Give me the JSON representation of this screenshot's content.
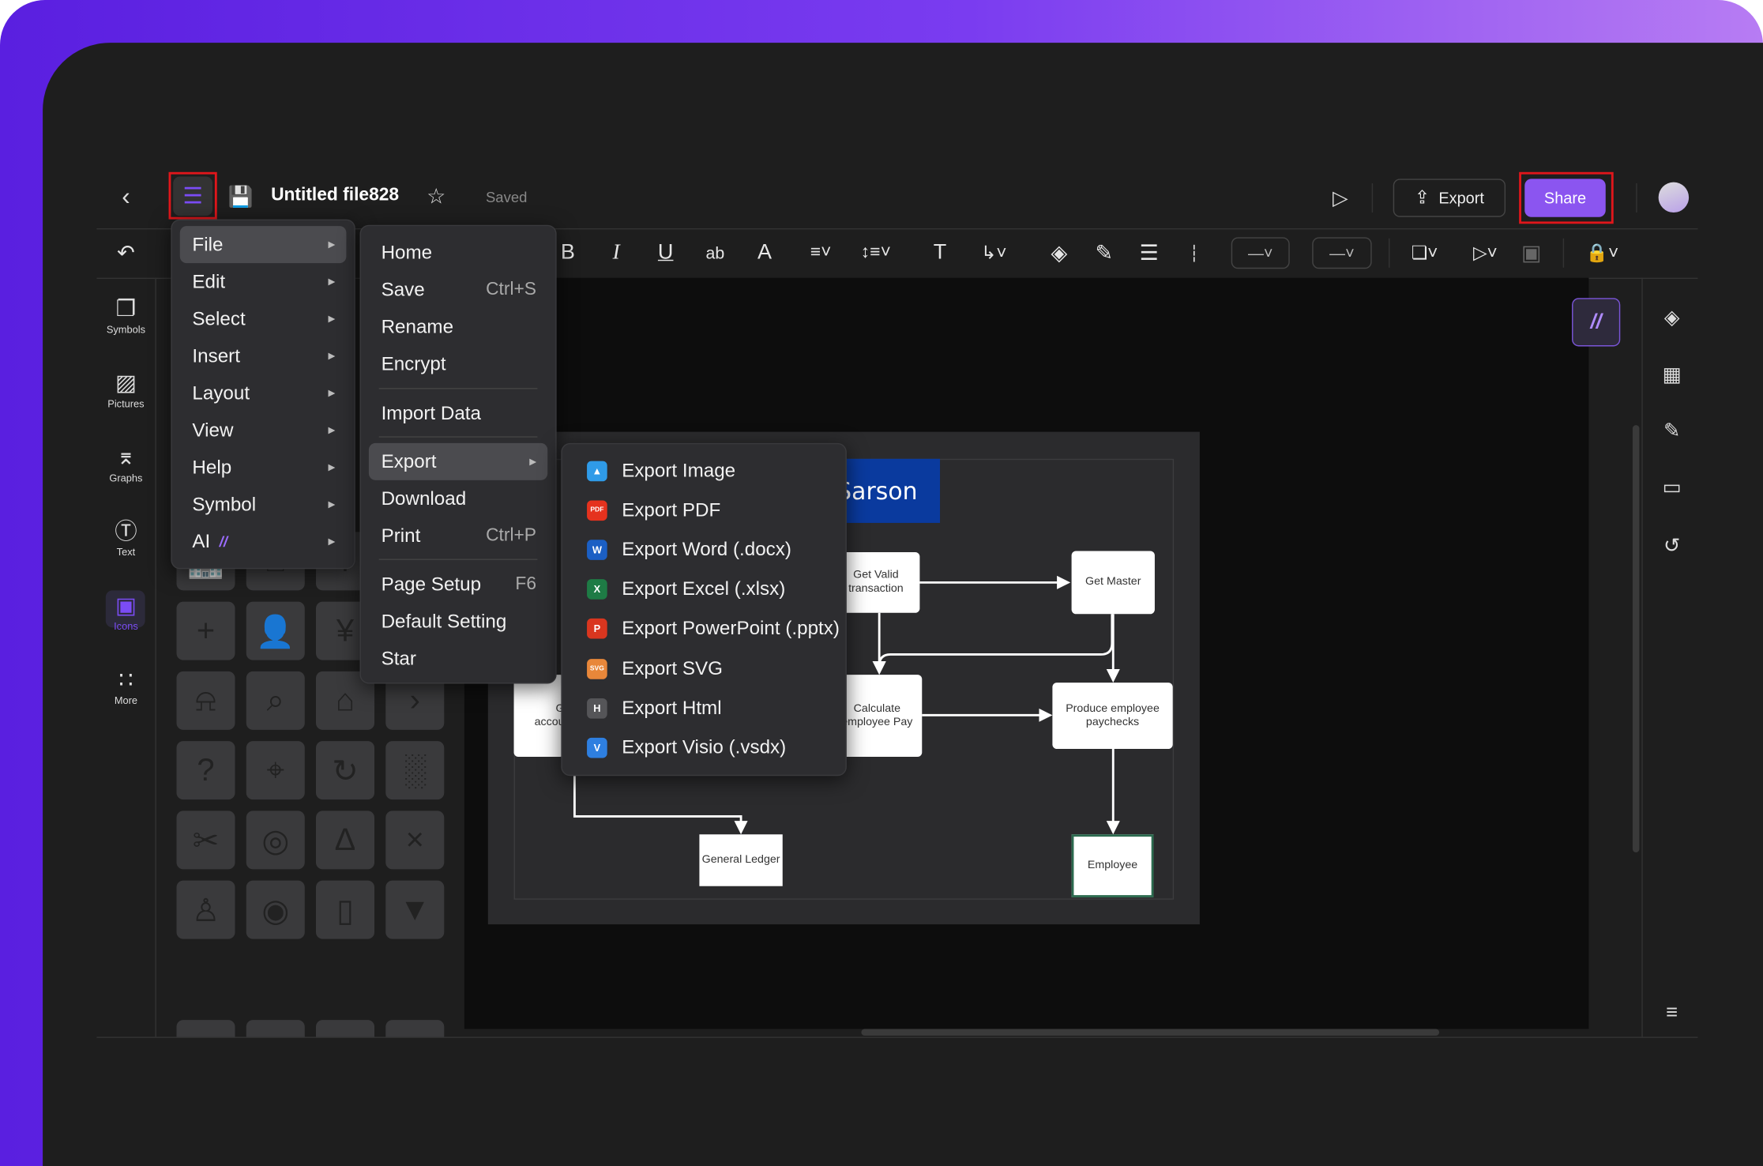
{
  "header": {
    "title": "Untitled file828",
    "status": "Saved",
    "export_label": "Export",
    "share_label": "Share"
  },
  "colors": {
    "accent": "#8b55f0",
    "highlight_outline": "#e0161b",
    "diagram_title_bg": "#0a3a9e"
  },
  "sidebar": {
    "items": [
      {
        "label": "Symbols",
        "icon": "symbols-icon"
      },
      {
        "label": "Pictures",
        "icon": "pictures-icon"
      },
      {
        "label": "Graphs",
        "icon": "graphs-icon"
      },
      {
        "label": "Text",
        "icon": "text-icon"
      },
      {
        "label": "Icons",
        "icon": "icons-icon",
        "active": true
      },
      {
        "label": "More",
        "icon": "more-icon"
      }
    ]
  },
  "icon_grid": [
    "building-icon",
    "easel-icon",
    "money-icon",
    "check-icon",
    "plus-icon",
    "contact-card-icon",
    "yen-transfer-icon",
    "chevron-down-icon",
    "bell-icon",
    "search-icon",
    "store-icon",
    "chevron-right-icon",
    "help-icon",
    "location-icon",
    "refresh-icon",
    "barcode-icon",
    "scissors-icon",
    "target-icon",
    "compass-icon",
    "close-icon",
    "stamp-icon",
    "disc-icon",
    "usb-icon",
    "pin-icon"
  ],
  "main_menu": {
    "items": [
      {
        "label": "File"
      },
      {
        "label": "Edit"
      },
      {
        "label": "Select"
      },
      {
        "label": "Insert"
      },
      {
        "label": "Layout"
      },
      {
        "label": "View"
      },
      {
        "label": "Help"
      },
      {
        "label": "Symbol"
      },
      {
        "label": "AI"
      }
    ]
  },
  "file_menu": {
    "items": [
      {
        "label": "Home"
      },
      {
        "label": "Save",
        "shortcut": "Ctrl+S"
      },
      {
        "label": "Rename"
      },
      {
        "label": "Encrypt"
      },
      {
        "label": "Import Data"
      },
      {
        "label": "Export"
      },
      {
        "label": "Download"
      },
      {
        "label": "Print",
        "shortcut": "Ctrl+P"
      },
      {
        "label": "Page Setup",
        "shortcut": "F6"
      },
      {
        "label": "Default Setting"
      },
      {
        "label": "Star"
      }
    ]
  },
  "export_menu": {
    "items": [
      {
        "label": "Export Image",
        "badge": "",
        "color": "#2f9be8"
      },
      {
        "label": "Export PDF",
        "badge": "PDF",
        "color": "#e5321e"
      },
      {
        "label": "Export Word (.docx)",
        "badge": "W",
        "color": "#1b5fc4"
      },
      {
        "label": "Export Excel (.xlsx)",
        "badge": "X",
        "color": "#1e7b45"
      },
      {
        "label": "Export PowerPoint (.pptx)",
        "badge": "P",
        "color": "#d9361f"
      },
      {
        "label": "Export SVG",
        "badge": "SVG",
        "color": "#e8873a"
      },
      {
        "label": "Export Html",
        "badge": "H",
        "color": "#555558"
      },
      {
        "label": "Export Visio (.vsdx)",
        "badge": "V",
        "color": "#2e7fe0"
      }
    ]
  },
  "diagram": {
    "title": "Sarson",
    "nodes": {
      "get_valid": "Get Valid transaction",
      "get_master": "Get Master",
      "calculate": "Calculate employee Pay",
      "produce": "Produce employee paychecks",
      "ledger": "General Ledger",
      "employee": "Employee",
      "left_top": "G",
      "left_bottom": "accou"
    }
  }
}
